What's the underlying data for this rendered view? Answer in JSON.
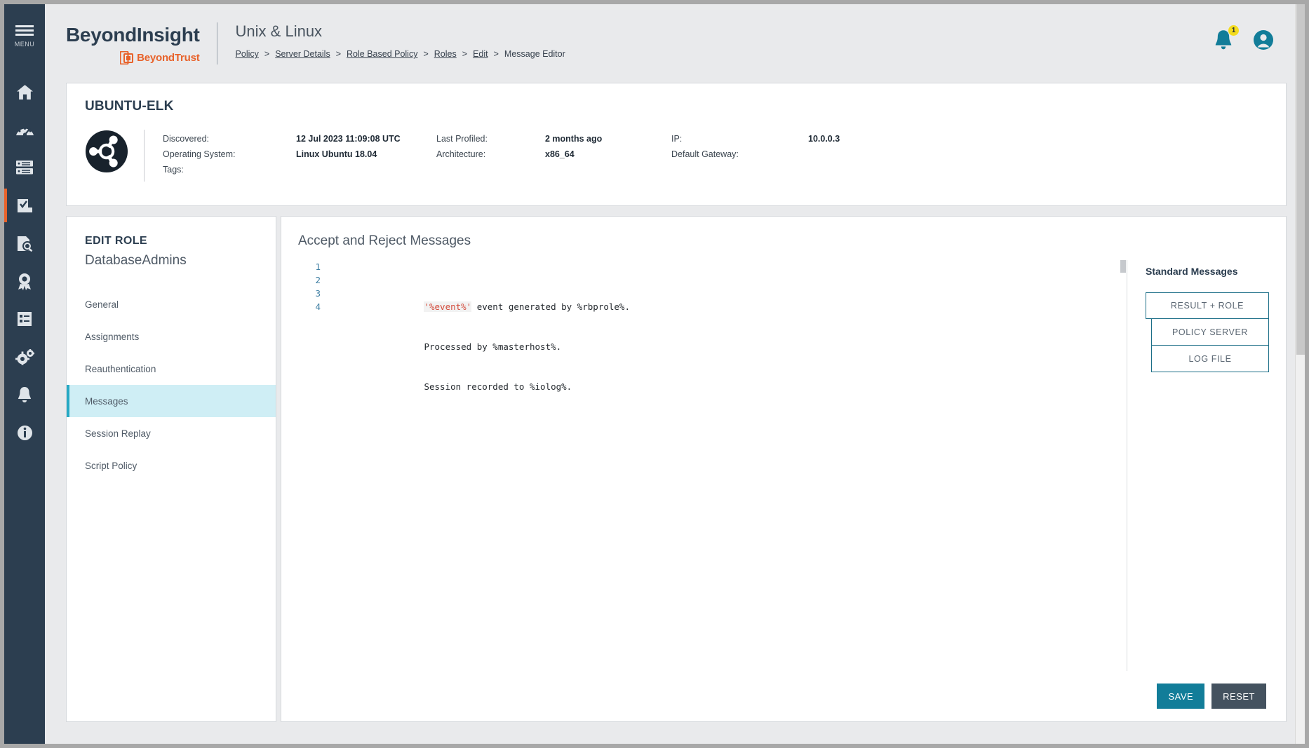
{
  "rail": {
    "menu_label": "MENU",
    "items": [
      {
        "name": "menu-icon",
        "label": "MENU"
      },
      {
        "name": "home-icon",
        "label": "Home"
      },
      {
        "name": "dashboard-gauge-icon",
        "label": "Dashboard"
      },
      {
        "name": "server-icon",
        "label": "Assets"
      },
      {
        "name": "policy-document-icon",
        "label": "Policy",
        "active": true
      },
      {
        "name": "scan-search-icon",
        "label": "Scan"
      },
      {
        "name": "award-badge-icon",
        "label": "Smart Rules"
      },
      {
        "name": "report-list-icon",
        "label": "Reports"
      },
      {
        "name": "gears-icon",
        "label": "Configuration"
      },
      {
        "name": "bell-icon",
        "label": "Notifications"
      },
      {
        "name": "info-icon",
        "label": "About"
      }
    ]
  },
  "header": {
    "brand_primary": "BeyondInsight",
    "brand_secondary": "BeyondTrust",
    "page_title": "Unix & Linux",
    "breadcrumbs": [
      "Policy",
      "Server Details",
      "Role Based Policy",
      "Roles",
      "Edit",
      "Message Editor"
    ],
    "breadcrumb_separator": ">",
    "notification_count": "1",
    "icons": {
      "bell": "bell-icon",
      "account": "user-account-icon"
    },
    "colors": {
      "brand_orange": "#e8622a",
      "brand_dark": "#2c3e50",
      "teal": "#127d99",
      "badge_yellow": "#f4dc1e"
    }
  },
  "host": {
    "name": "UBUNTU-ELK",
    "logo": "ubuntu-logo-icon",
    "fields": [
      {
        "label": "Discovered:",
        "value": "12 Jul 2023 11:09:08 UTC"
      },
      {
        "label": "Last Profiled:",
        "value": "2 months ago"
      },
      {
        "label": "IP:",
        "value": "10.0.0.3"
      },
      {
        "label": "Operating System:",
        "value": "Linux Ubuntu 18.04"
      },
      {
        "label": "Architecture:",
        "value": "x86_64"
      },
      {
        "label": "Default Gateway:",
        "value": ""
      },
      {
        "label": "Tags:",
        "value": ""
      }
    ]
  },
  "edit_role": {
    "title": "EDIT ROLE",
    "role_name": "DatabaseAdmins",
    "nav": [
      {
        "label": "General",
        "active": false
      },
      {
        "label": "Assignments",
        "active": false
      },
      {
        "label": "Reauthentication",
        "active": false
      },
      {
        "label": "Messages",
        "active": true
      },
      {
        "label": "Session Replay",
        "active": false
      },
      {
        "label": "Script Policy",
        "active": false
      }
    ]
  },
  "editor": {
    "title": "Accept and Reject Messages",
    "line_numbers": [
      "1",
      "2",
      "3",
      "4"
    ],
    "lines": [
      {
        "prefix": "",
        "quoted": "'%event%'",
        "rest": " event generated by %rbprole%. "
      },
      {
        "prefix": "Processed by %masterhost%. ",
        "quoted": "",
        "rest": ""
      },
      {
        "prefix": "Session recorded to %iolog%. ",
        "quoted": "",
        "rest": ""
      },
      {
        "prefix": "",
        "quoted": "",
        "rest": ""
      }
    ],
    "plain_text": "'%event%' event generated by %rbprole%.\nProcessed by %masterhost%.\nSession recorded to %iolog%.\n"
  },
  "standard_messages": {
    "title": "Standard Messages",
    "buttons": [
      {
        "label": "RESULT + ROLE"
      },
      {
        "label": "POLICY SERVER"
      },
      {
        "label": "LOG FILE"
      }
    ]
  },
  "footer": {
    "save_label": "SAVE",
    "reset_label": "RESET"
  }
}
